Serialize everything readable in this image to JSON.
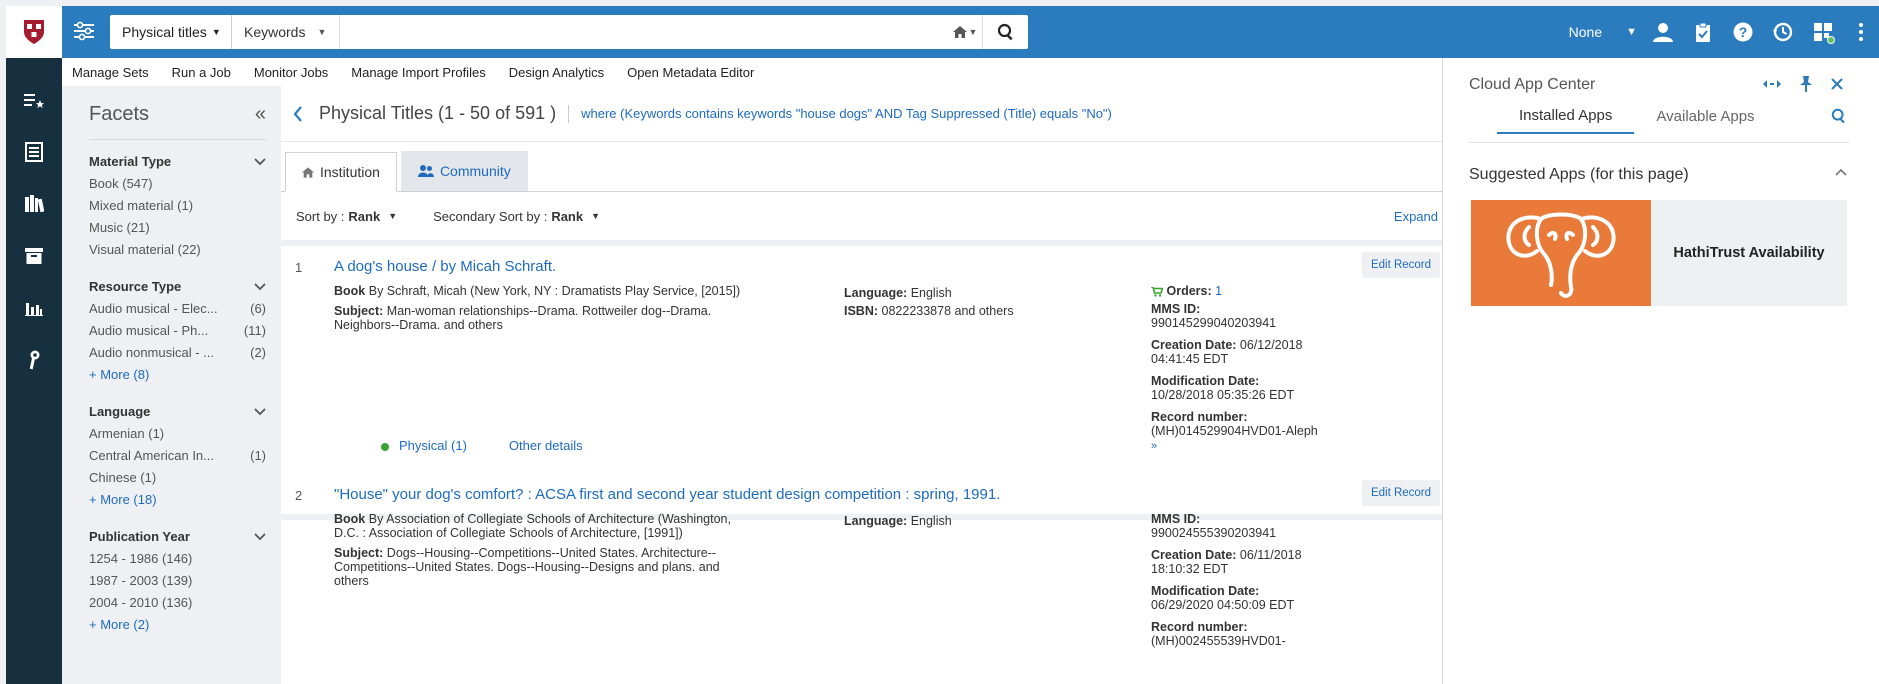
{
  "search": {
    "scope": "Physical titles",
    "field": "Keywords",
    "value": ""
  },
  "top_right": {
    "institution": "None"
  },
  "subbar": {
    "links": [
      "Manage Sets",
      "Run a Job",
      "Monitor Jobs",
      "Manage Import Profiles",
      "Design Analytics",
      "Open Metadata Editor"
    ]
  },
  "facets": {
    "title": "Facets",
    "groups": [
      {
        "title": "Material Type",
        "items": [
          {
            "label": "Book (547)",
            "count": ""
          },
          {
            "label": "Mixed material (1)",
            "count": ""
          },
          {
            "label": "Music (21)",
            "count": ""
          },
          {
            "label": "Visual material (22)",
            "count": ""
          }
        ],
        "more": ""
      },
      {
        "title": "Resource Type",
        "items": [
          {
            "label": "Audio musical - Elec...",
            "count": "(6)"
          },
          {
            "label": "Audio musical - Ph...",
            "count": "(11)"
          },
          {
            "label": "Audio nonmusical - ...",
            "count": "(2)"
          }
        ],
        "more": "+ More (8)"
      },
      {
        "title": "Language",
        "items": [
          {
            "label": "Armenian (1)",
            "count": ""
          },
          {
            "label": "Central American In...",
            "count": "(1)"
          },
          {
            "label": "Chinese (1)",
            "count": ""
          }
        ],
        "more": "+ More (18)"
      },
      {
        "title": "Publication Year",
        "items": [
          {
            "label": "1254 - 1986 (146)",
            "count": ""
          },
          {
            "label": "1987 - 2003 (139)",
            "count": ""
          },
          {
            "label": "2004 - 2010 (136)",
            "count": ""
          }
        ],
        "more": "+ More (2)"
      }
    ]
  },
  "main": {
    "title": "Physical Titles (1 - 50 of 591 )",
    "criteria": "where (Keywords contains keywords \"house dogs\" AND Tag Suppressed (Title) equals \"No\")",
    "tabs": [
      "Institution",
      "Community"
    ],
    "sort": {
      "label": "Sort by :",
      "value": "Rank",
      "secondary_label": "Secondary Sort by :",
      "secondary_value": "Rank",
      "expand": "Expand"
    },
    "edit_label": "Edit Record",
    "records": [
      {
        "num": "1",
        "title": "A dog's house / by Micah Schraft.",
        "type": "Book",
        "by": "By Schraft, Micah (New York, NY : Dramatists Play Service, [2015])",
        "subject_label": "Subject:",
        "subject": "Man-woman relationships--Drama. Rottweiler dog--Drama. Neighbors--Drama. and others",
        "language_label": "Language:",
        "language": "English",
        "isbn_label": "ISBN:",
        "isbn": "0822233878 and others",
        "orders_label": "Orders:",
        "orders": "1",
        "mms_label": "MMS ID:",
        "mms": "990145299040203941",
        "created_label": "Creation Date:",
        "created": "06/12/2018 04:41:45 EDT",
        "modified_label": "Modification Date:",
        "modified": "10/28/2018 05:35:26 EDT",
        "recnum_label": "Record number:",
        "recnum": "(MH)014529904HVD01-Aleph",
        "physical": "Physical (1)",
        "other": "Other details"
      },
      {
        "num": "2",
        "title": "\"House\" your dog's comfort? : ACSA first and second year student design competition : spring, 1991.",
        "type": "Book",
        "by": "By Association of Collegiate Schools of Architecture (Washington, D.C. : Association of Collegiate Schools of Architecture, [1991])",
        "subject_label": "Subject:",
        "subject": "Dogs--Housing--Competitions--United States. Architecture--Competitions--United States. Dogs--Housing--Designs and plans. and others",
        "language_label": "Language:",
        "language": "English",
        "mms_label": "MMS ID:",
        "mms": "990024555390203941",
        "created_label": "Creation Date:",
        "created": "06/11/2018 18:10:32 EDT",
        "modified_label": "Modification Date:",
        "modified": "06/29/2020 04:50:09 EDT",
        "recnum_label": "Record number:",
        "recnum": "(MH)002455539HVD01-"
      }
    ]
  },
  "panel": {
    "title": "Cloud App Center",
    "tabs": [
      "Installed Apps",
      "Available Apps"
    ],
    "suggested": "Suggested Apps (for this page)",
    "app_name": "HathiTrust Availability"
  },
  "colors": {
    "topbar": "#2b7bbf",
    "rail": "#16303f",
    "link": "#1e6bbf",
    "app_orange": "#ea7a3a"
  }
}
